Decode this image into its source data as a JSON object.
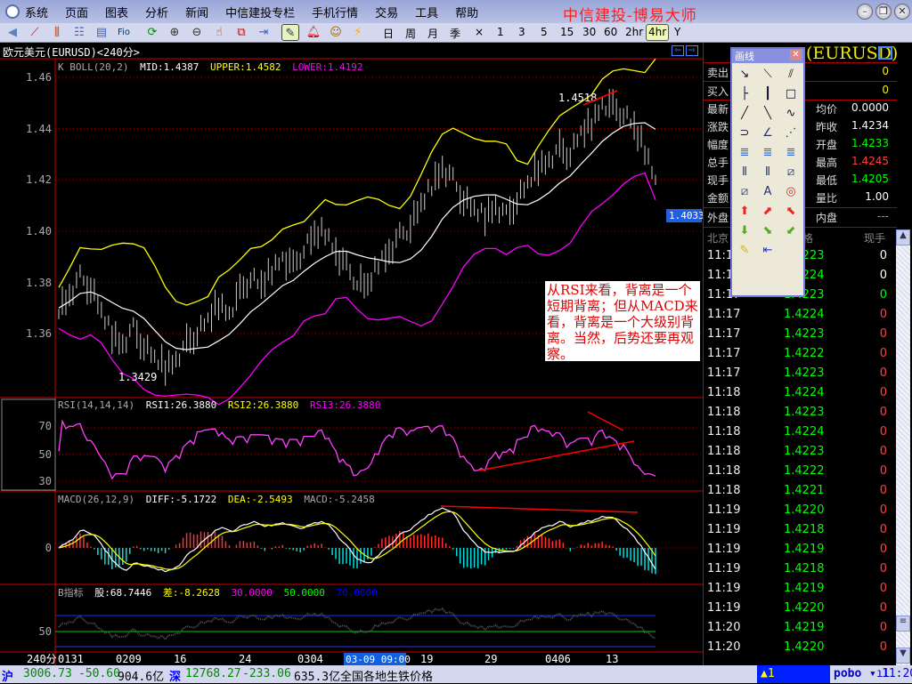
{
  "window": {
    "title": "中信建投-博易大师"
  },
  "menu": [
    "系统",
    "页面",
    "图表",
    "分析",
    "新闻",
    "中信建投专栏",
    "手机行情",
    "交易",
    "工具",
    "帮助"
  ],
  "toolbar": {
    "icons": [
      "back-icon",
      "line-chart-icon",
      "candle-chart-icon",
      "list-icon",
      "quote-icon",
      "f10-icon",
      "refresh-icon",
      "zoom-in-icon",
      "zoom-out-icon",
      "pointer-icon",
      "window-icon",
      "export-icon",
      "draw-line-icon",
      "alarm-icon",
      "users-icon",
      "lightning-icon"
    ],
    "periods": [
      "日",
      "周",
      "月",
      "季",
      "×",
      "1",
      "3",
      "5",
      "15",
      "30",
      "60",
      "2hr",
      "4hr",
      "Y"
    ],
    "selected_period": "4hr"
  },
  "chart": {
    "title": "欧元美元(EURUSD)<240分>",
    "main_header": {
      "name": "K  BOLL(20,2)",
      "mid": "MID:1.4387",
      "upper": "UPPER:1.4582",
      "lower": "LOWER:1.4192"
    },
    "price_ticks": [
      "1.46",
      "1.44",
      "1.42",
      "1.40",
      "1.38",
      "1.36"
    ],
    "high_label": "1.4518",
    "low_label": "1.3429",
    "last_price_tag": "1.4033",
    "rsi_header": {
      "name": "RSI(14,14,14)",
      "rsi1": "RSI1:26.3880",
      "rsi2": "RSI2:26.3880",
      "rsi3": "RSI3:26.3880"
    },
    "rsi_ticks": [
      "70",
      "50",
      "30"
    ],
    "macd_header": {
      "name": "MACD(26,12,9)",
      "diff": "DIFF:-5.1722",
      "dea": "DEA:-2.5493",
      "macd": "MACD:-5.2458"
    },
    "macd_ticks": [
      "0"
    ],
    "b_header": {
      "name": "B指标",
      "gu": "股:68.7446",
      "cha": "差:-8.2628",
      "l30": "30.0000",
      "l50": "50.0000",
      "l70": "70.0000"
    },
    "b_ticks": [
      "50"
    ],
    "x_labels": [
      "0131",
      "0209",
      "16",
      "24",
      "0304",
      "19",
      "29",
      "0406",
      "13"
    ],
    "period_label": "240分",
    "cursor_time": "03-09 09:00",
    "annotation": "从RSI来看，背离是一个短期背离；但从MACD来看，背离是一个大级别背离。当然，后势还要再观察。",
    "colors": {
      "mid": "#ffffff",
      "upper": "#ffff00",
      "lower": "#ff00ff",
      "rsi": "#ff40ff",
      "macd_up": "#ff3030",
      "macd_down": "#00e0e0",
      "trendline": "#ff0000"
    }
  },
  "chart_data": {
    "type": "line",
    "title": "欧元美元(EURUSD)<240分>",
    "ylim": [
      1.34,
      1.465
    ],
    "closes": [
      1.37,
      1.375,
      1.382,
      1.378,
      1.368,
      1.36,
      1.356,
      1.362,
      1.355,
      1.35,
      1.347,
      1.35,
      1.356,
      1.36,
      1.365,
      1.372,
      1.368,
      1.376,
      1.382,
      1.378,
      1.385,
      1.39,
      1.386,
      1.393,
      1.398,
      1.4,
      1.392,
      1.386,
      1.38,
      1.378,
      1.388,
      1.392,
      1.398,
      1.402,
      1.41,
      1.418,
      1.425,
      1.42,
      1.412,
      1.408,
      1.406,
      1.41,
      1.406,
      1.412,
      1.418,
      1.425,
      1.428,
      1.432,
      1.43,
      1.438,
      1.442,
      1.45,
      1.448,
      1.446,
      1.44,
      1.432,
      1.42
    ]
  },
  "quote": {
    "symbol": "(EURUSD)",
    "sell": {
      "label": "卖出",
      "value": "0"
    },
    "buy": {
      "label": "买入",
      "value": "0"
    },
    "rows": [
      {
        "l": "最新",
        "r": "均价",
        "v": "0.0000",
        "c": "#ffffff"
      },
      {
        "l": "涨跌",
        "r": "昨收",
        "v": "1.4234",
        "c": "#ffffff"
      },
      {
        "l": "幅度",
        "r": "开盘",
        "v": "1.4233",
        "c": "#00ff00"
      },
      {
        "l": "总手",
        "r": "最高",
        "v": "1.4245",
        "c": "#ff4040"
      },
      {
        "l": "现手",
        "r": "最低",
        "v": "1.4205",
        "c": "#00ff00"
      },
      {
        "l": "金额",
        "r": "量比",
        "v": "1.00",
        "c": "#ffffff"
      }
    ],
    "outer": {
      "label": "外盘"
    },
    "inner": {
      "label": "内盘",
      "value": "---"
    },
    "ticks_header": {
      "time": "北京",
      "price": "格",
      "vol": "现手"
    }
  },
  "ticks": [
    {
      "t": "11:17",
      "p": "1.4223",
      "v": "0",
      "vc": "#ffffff"
    },
    {
      "t": "11:17",
      "p": "1.4224",
      "v": "0",
      "vc": "#ffffff"
    },
    {
      "t": "11:17",
      "p": "1.4223",
      "v": "0",
      "vc": "#00ff00"
    },
    {
      "t": "11:17",
      "p": "1.4224",
      "v": "0",
      "vc": "#ff4040"
    },
    {
      "t": "11:17",
      "p": "1.4223",
      "v": "0",
      "vc": "#ff4040"
    },
    {
      "t": "11:17",
      "p": "1.4222",
      "v": "0",
      "vc": "#ff4040"
    },
    {
      "t": "11:17",
      "p": "1.4223",
      "v": "0",
      "vc": "#ff4040"
    },
    {
      "t": "11:18",
      "p": "1.4224",
      "v": "0",
      "vc": "#ff4040"
    },
    {
      "t": "11:18",
      "p": "1.4223",
      "v": "0",
      "vc": "#ff4040"
    },
    {
      "t": "11:18",
      "p": "1.4224",
      "v": "0",
      "vc": "#ff4040"
    },
    {
      "t": "11:18",
      "p": "1.4223",
      "v": "0",
      "vc": "#ff4040"
    },
    {
      "t": "11:18",
      "p": "1.4222",
      "v": "0",
      "vc": "#ff4040"
    },
    {
      "t": "11:18",
      "p": "1.4221",
      "v": "0",
      "vc": "#ff4040"
    },
    {
      "t": "11:19",
      "p": "1.4220",
      "v": "0",
      "vc": "#ff4040"
    },
    {
      "t": "11:19",
      "p": "1.4218",
      "v": "0",
      "vc": "#ff4040"
    },
    {
      "t": "11:19",
      "p": "1.4219",
      "v": "0",
      "vc": "#ff4040"
    },
    {
      "t": "11:19",
      "p": "1.4218",
      "v": "0",
      "vc": "#ff4040"
    },
    {
      "t": "11:19",
      "p": "1.4219",
      "v": "0",
      "vc": "#ff4040"
    },
    {
      "t": "11:19",
      "p": "1.4220",
      "v": "0",
      "vc": "#ff4040"
    },
    {
      "t": "11:20",
      "p": "1.4219",
      "v": "0",
      "vc": "#ff4040"
    },
    {
      "t": "11:20",
      "p": "1.4220",
      "v": "0",
      "vc": "#ff4040"
    }
  ],
  "drawtool": {
    "title": "画线",
    "tools": [
      "↘",
      "⟍",
      "⫽",
      "├",
      "┃",
      "□",
      "╱",
      "╲",
      "∿",
      "⊃",
      "∠",
      "⋰",
      "≣",
      "≣",
      "≣",
      "⦀",
      "⦀",
      "⧄",
      "⧄",
      "A",
      "◎",
      "⬆",
      "⬈",
      "⬉",
      "⬇",
      "⬊",
      "⬋",
      "✎",
      "⇤"
    ]
  },
  "status": {
    "sh_label": "沪",
    "sh_index": "3006.73",
    "sh_change": "-50.60",
    "sh_amount": "904.6亿",
    "sz_label": "深",
    "sz_index": "12768.27",
    "sz_change": "-233.06",
    "sz_amount": "635.3亿",
    "news": "全国各地生铁价格",
    "alert": "▲1",
    "brand": "pobo",
    "time": "11:20"
  }
}
